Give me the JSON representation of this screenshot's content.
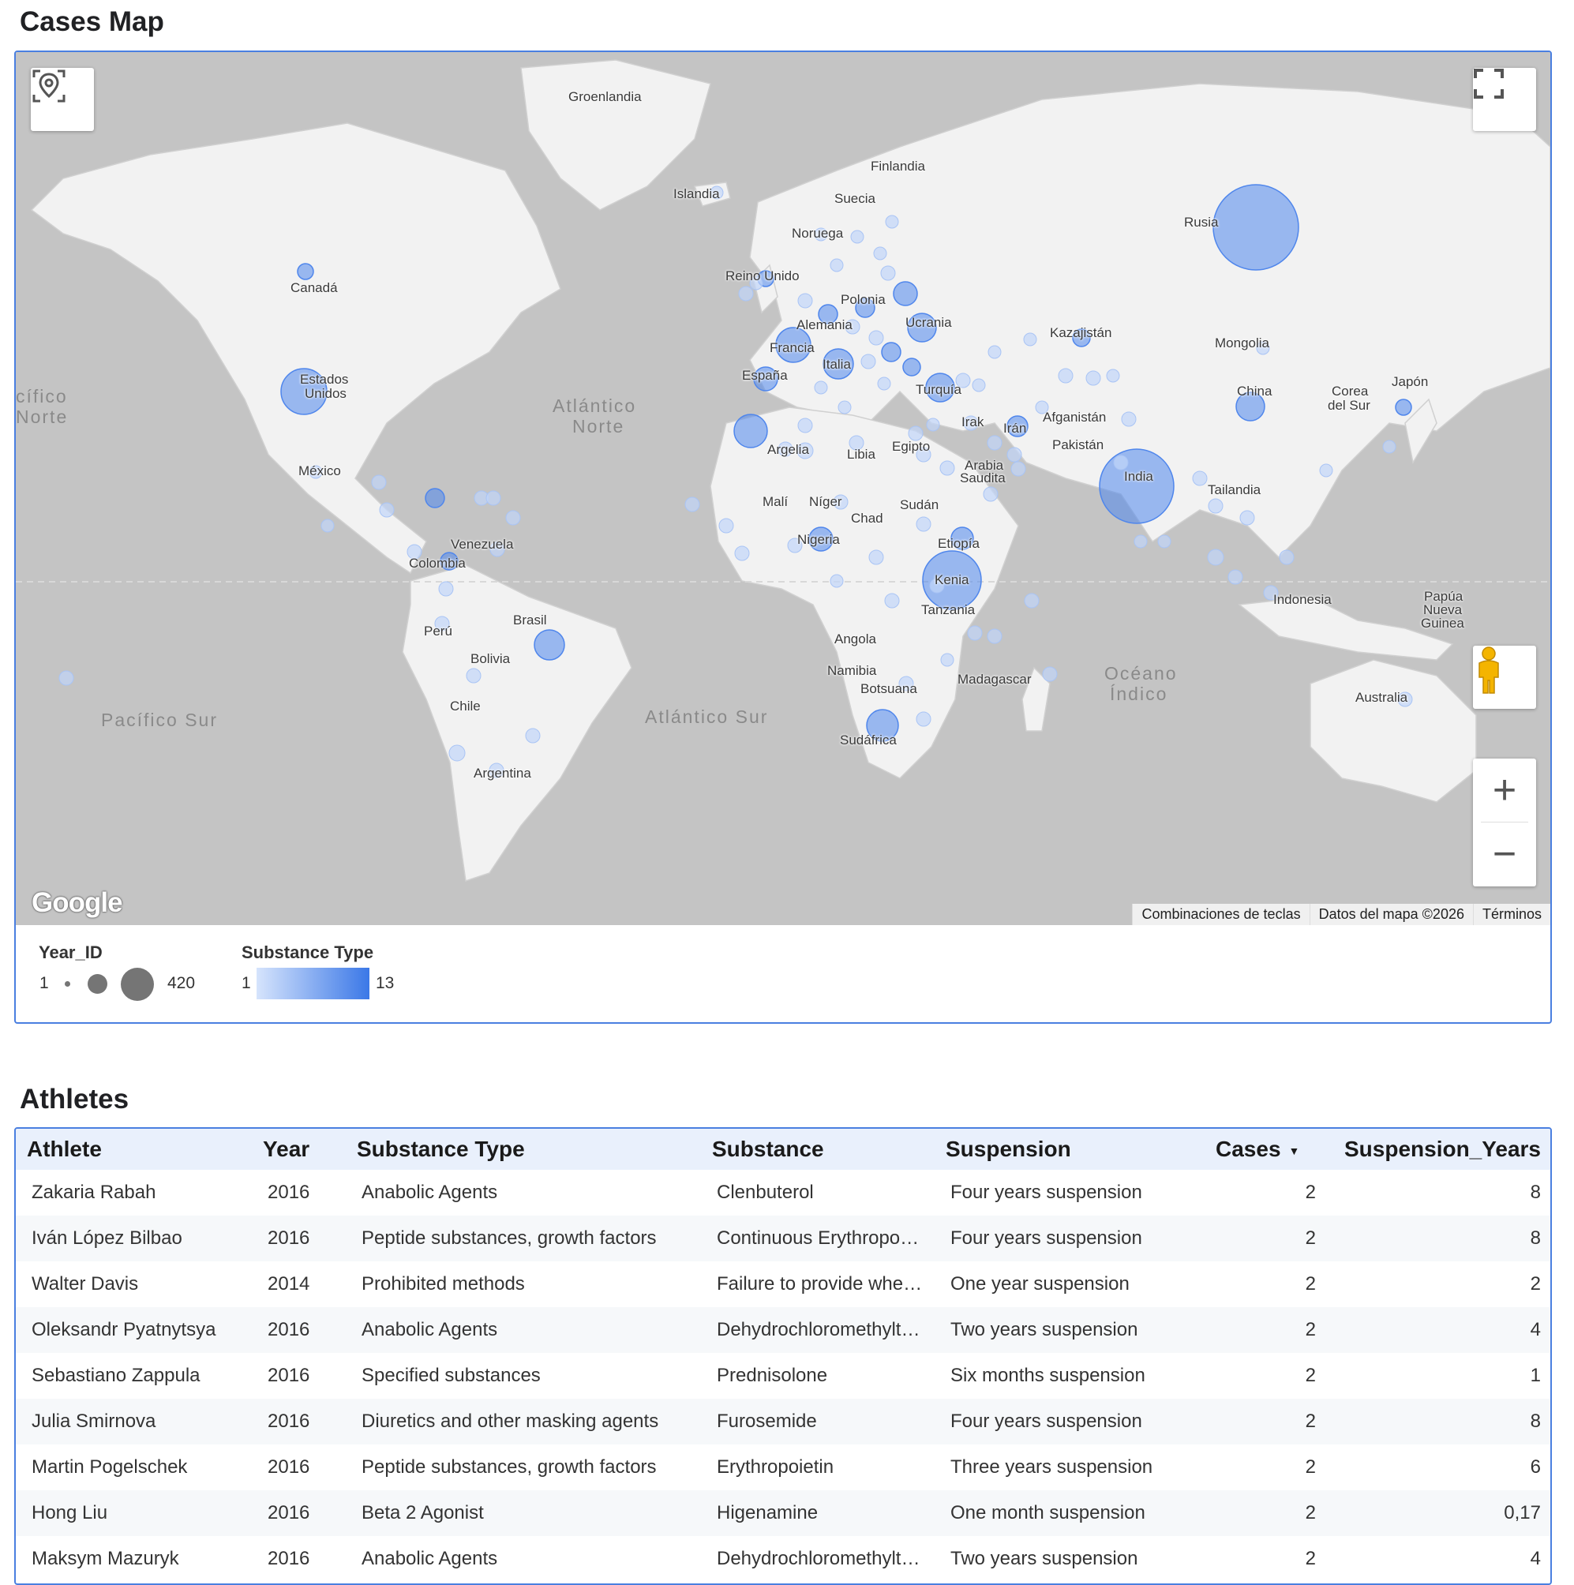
{
  "sections": {
    "map_title": "Cases Map",
    "athletes_title": "Athletes"
  },
  "map": {
    "labels": {
      "groenlandia": "Groenlandia",
      "finlandia": "Finlandia",
      "islandia": "Islandia",
      "suecia": "Suecia",
      "noruega": "Noruega",
      "reino_unido": "Reino Unido",
      "rusia": "Rusia",
      "canada": "Canadá",
      "polonia": "Polonia",
      "alemania": "Alemania",
      "ucrania": "Ucrania",
      "kazajistan": "Kazajistán",
      "francia": "Francia",
      "mongolia": "Mongolia",
      "italia": "Italia",
      "estados_unidos_1": "Estados",
      "estados_unidos_2": "Unidos",
      "espana": "España",
      "turquia": "Turquía",
      "corea_1": "Corea",
      "corea_2": "del Sur",
      "japon": "Japón",
      "china": "China",
      "irak": "Irak",
      "iran": "Irán",
      "afganistan": "Afganistán",
      "argelia": "Argelia",
      "libia": "Libia",
      "egipto": "Egipto",
      "pakistan": "Pakistán",
      "mexico": "México",
      "arabia_1": "Arabia",
      "arabia_2": "Saudita",
      "india": "India",
      "tailandia": "Tailandia",
      "mali": "Malí",
      "niger": "Níger",
      "sudan": "Sudán",
      "chad": "Chad",
      "venezuela": "Venezuela",
      "nigeria": "Nigeria",
      "etiopia": "Etiopía",
      "colombia": "Colombia",
      "kenia": "Kenia",
      "tanzania": "Tanzania",
      "brasil": "Brasil",
      "indonesia": "Indonesia",
      "papua_1": "Papúa",
      "papua_2": "Nueva",
      "papua_3": "Guinea",
      "peru": "Perú",
      "angola": "Angola",
      "bolivia": "Bolivia",
      "namibia": "Namibia",
      "madagascar": "Madagascar",
      "botsuana": "Botsuana",
      "australia": "Australia",
      "chile": "Chile",
      "sudafrica": "Sudáfrica",
      "argentina": "Argentina"
    },
    "oceans": {
      "pacifico_norte_1": "cífico",
      "pacifico_norte_2": "Norte",
      "atlantico_norte_1": "Atlántico",
      "atlantico_norte_2": "Norte",
      "pacifico_sur": "Pacífico Sur",
      "atlantico_sur": "Atlántico Sur",
      "indico_1": "Océano",
      "indico_2": "Índico"
    },
    "google_logo": "Google",
    "attribution": {
      "shortcuts": "Combinaciones de teclas",
      "data": "Datos del mapa ©2026",
      "terms": "Términos"
    },
    "zoom_in": "+",
    "zoom_out": "−",
    "bubble_color": "#4f86ec"
  },
  "legend": {
    "size_title": "Year_ID",
    "size_min": "1",
    "size_max": "420",
    "color_title": "Substance Type",
    "color_min": "1",
    "color_max": "13",
    "color_from": "#d6e4fc",
    "color_to": "#3b78e7"
  },
  "table": {
    "columns": [
      "Athlete",
      "Year",
      "Substance Type",
      "Substance",
      "Suspension",
      "Cases",
      "Suspension_Years"
    ],
    "sort_indicator": "▼",
    "rows": [
      [
        "Zakaria Rabah",
        "2016",
        "Anabolic Agents",
        "Clenbuterol",
        "Four years suspension",
        "2",
        "8"
      ],
      [
        "Iván López Bilbao",
        "2016",
        "Peptide substances, growth factors",
        "Continuous Erythropo…",
        "Four years suspension",
        "2",
        "8"
      ],
      [
        "Walter Davis",
        "2014",
        "Prohibited methods",
        "Failure to provide whe…",
        "One year suspension",
        "2",
        "2"
      ],
      [
        "Oleksandr Pyatnytsya",
        "2016",
        "Anabolic Agents",
        "Dehydrochloromethylt…",
        "Two years suspension",
        "2",
        "4"
      ],
      [
        "Sebastiano Zappula",
        "2016",
        "Specified substances",
        "Prednisolone",
        "Six months suspension",
        "2",
        "1"
      ],
      [
        "Julia Smirnova",
        "2016",
        "Diuretics and other masking agents",
        "Furosemide",
        "Four years suspension",
        "2",
        "8"
      ],
      [
        "Martin Pogelschek",
        "2016",
        "Peptide substances, growth factors",
        "Erythropoietin",
        "Three years suspension",
        "2",
        "6"
      ],
      [
        "Hong Liu",
        "2016",
        "Beta 2 Agonist",
        "Higenamine",
        "One month suspension",
        "2",
        "0,17"
      ],
      [
        "Maksym Mazuryk",
        "2016",
        "Anabolic Agents",
        "Dehydrochloromethylt…",
        "Two years suspension",
        "2",
        "4"
      ]
    ]
  }
}
